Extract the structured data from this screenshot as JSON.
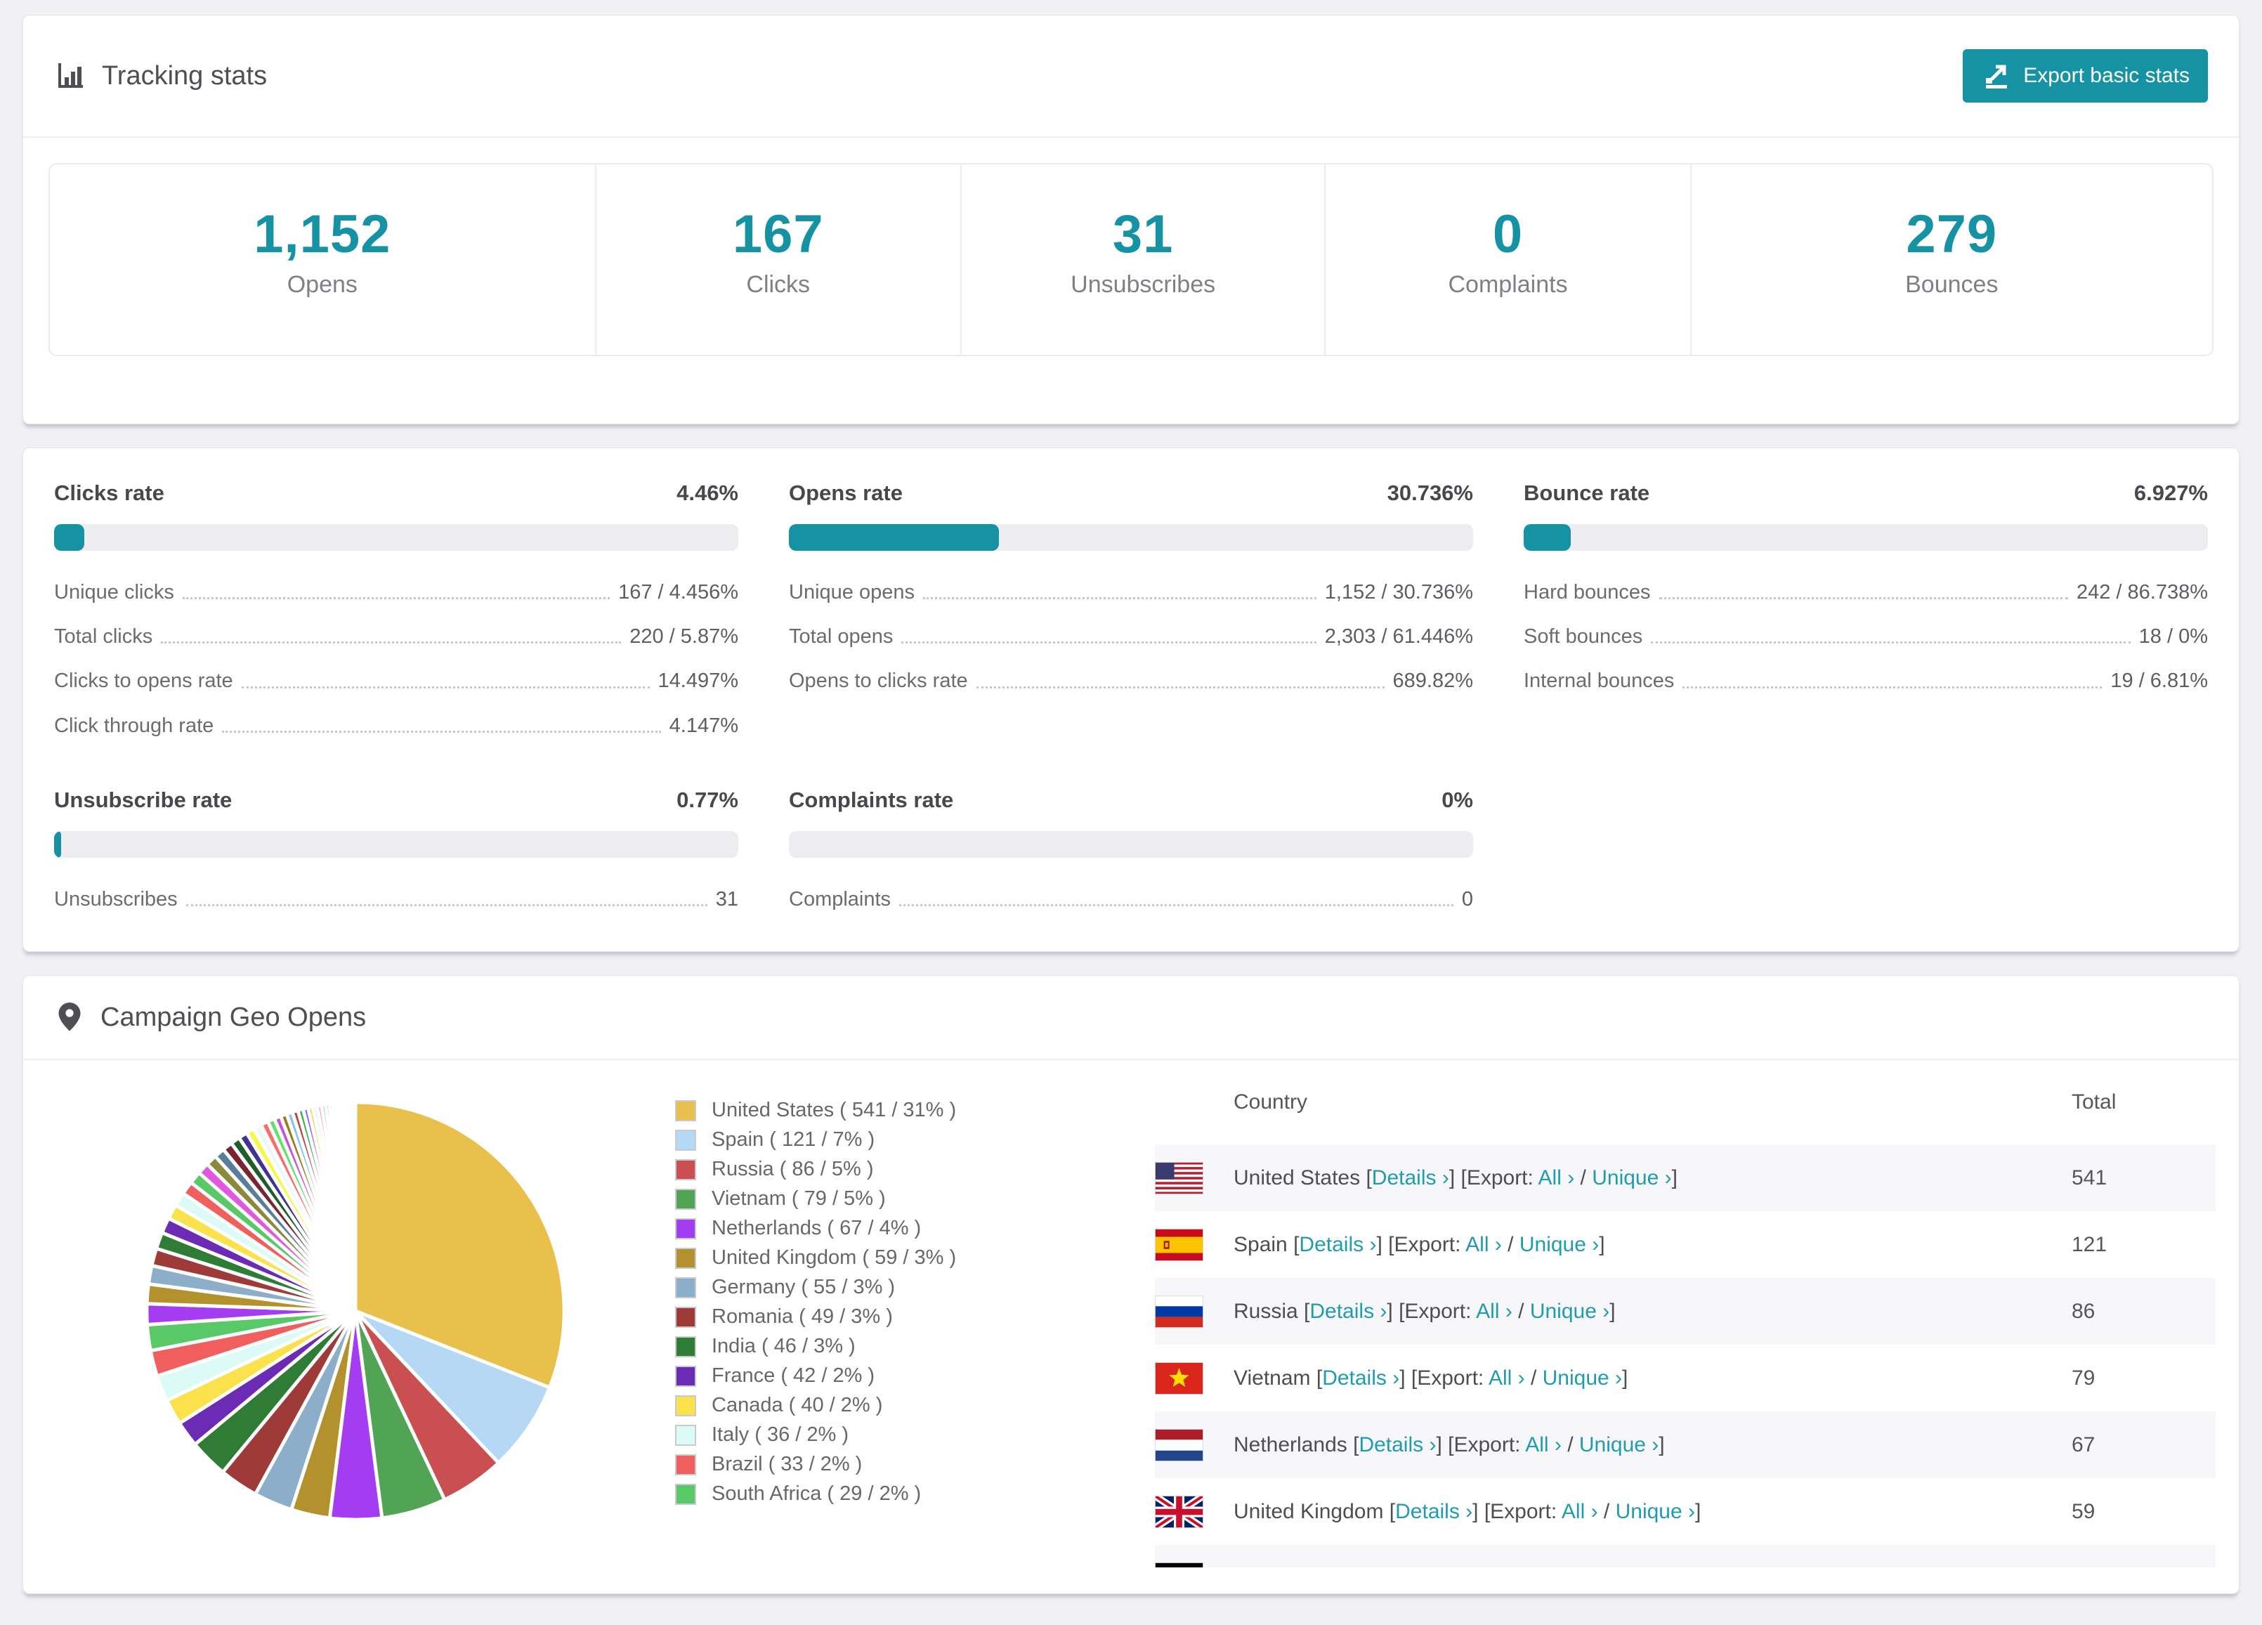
{
  "colors": {
    "accent": "#1592a3",
    "link": "#1f9cae"
  },
  "tracking": {
    "title": "Tracking stats",
    "export_label": "Export basic stats",
    "cards": [
      {
        "value": "1,152",
        "label": "Opens"
      },
      {
        "value": "167",
        "label": "Clicks"
      },
      {
        "value": "31",
        "label": "Unsubscribes"
      },
      {
        "value": "0",
        "label": "Complaints"
      },
      {
        "value": "279",
        "label": "Bounces"
      }
    ]
  },
  "rates": {
    "blocks": [
      {
        "id": "clicks",
        "title": "Clicks rate",
        "percent_label": "4.46%",
        "percent_value": 4.46,
        "rows": [
          [
            "Unique clicks",
            "167 / 4.456%"
          ],
          [
            "Total clicks",
            "220 / 5.87%"
          ],
          [
            "Clicks to opens rate",
            "14.497%"
          ],
          [
            "Click through rate",
            "4.147%"
          ]
        ]
      },
      {
        "id": "opens",
        "title": "Opens rate",
        "percent_label": "30.736%",
        "percent_value": 30.736,
        "rows": [
          [
            "Unique opens",
            "1,152 / 30.736%"
          ],
          [
            "Total opens",
            "2,303 / 61.446%"
          ],
          [
            "Opens to clicks rate",
            "689.82%"
          ]
        ]
      },
      {
        "id": "bounce",
        "title": "Bounce rate",
        "percent_label": "6.927%",
        "percent_value": 6.927,
        "rows": [
          [
            "Hard bounces",
            "242 / 86.738%"
          ],
          [
            "Soft bounces",
            "18 / 0%"
          ],
          [
            "Internal bounces",
            "19 / 6.81%"
          ]
        ]
      },
      {
        "id": "unsubscribe",
        "title": "Unsubscribe rate",
        "percent_label": "0.77%",
        "percent_value": 0.77,
        "rows": [
          [
            "Unsubscribes",
            "31"
          ]
        ]
      },
      {
        "id": "complaints",
        "title": "Complaints rate",
        "percent_label": "0%",
        "percent_value": 0,
        "rows": [
          [
            "Complaints",
            "0"
          ]
        ]
      }
    ]
  },
  "geo": {
    "title": "Campaign Geo Opens",
    "chart_data": {
      "type": "pie",
      "legend_position": "right",
      "series": [
        {
          "name": "United States",
          "value": 541,
          "percent": 31,
          "color": "#e9c04b"
        },
        {
          "name": "Spain",
          "value": 121,
          "percent": 7,
          "color": "#b5d8f5"
        },
        {
          "name": "Russia",
          "value": 86,
          "percent": 5,
          "color": "#c94f50"
        },
        {
          "name": "Vietnam",
          "value": 79,
          "percent": 5,
          "color": "#52a455"
        },
        {
          "name": "Netherlands",
          "value": 67,
          "percent": 4,
          "color": "#a43df2"
        },
        {
          "name": "United Kingdom",
          "value": 59,
          "percent": 3,
          "color": "#b3922e"
        },
        {
          "name": "Germany",
          "value": 55,
          "percent": 3,
          "color": "#8caec9"
        },
        {
          "name": "Romania",
          "value": 49,
          "percent": 3,
          "color": "#9e3b38"
        },
        {
          "name": "India",
          "value": 46,
          "percent": 3,
          "color": "#2e7c35"
        },
        {
          "name": "France",
          "value": 42,
          "percent": 2,
          "color": "#6c2bb4"
        },
        {
          "name": "Canada",
          "value": 40,
          "percent": 2,
          "color": "#fbe14b"
        },
        {
          "name": "Italy",
          "value": 36,
          "percent": 2,
          "color": "#dcfbf7"
        },
        {
          "name": "Brazil",
          "value": 33,
          "percent": 2,
          "color": "#f15e5e"
        },
        {
          "name": "South Africa",
          "value": 29,
          "percent": 2,
          "color": "#59c867"
        }
      ],
      "others": {
        "count": 40,
        "start_percent": 1.6,
        "decay": 0.945,
        "colors": [
          "#a43df2",
          "#b3922e",
          "#8caec9",
          "#9e3b38",
          "#2e7c35",
          "#6c2bb4",
          "#fbe14b",
          "#dcfbf7",
          "#f15e5e",
          "#59c867",
          "#e157e0",
          "#8a8a3a",
          "#5a7d9a",
          "#7a2430",
          "#1f5d2a",
          "#403394",
          "#f7f74a",
          "#eef7ff",
          "#fa6b6b",
          "#67e06b",
          "#c44fd9",
          "#9a7b20",
          "#88c4f0",
          "#c23b3b",
          "#3fae4c",
          "#8b5cf6",
          "#ffd34d",
          "#d0f4ff",
          "#ff8787",
          "#4ade80"
        ]
      }
    },
    "table": {
      "columns": [
        "Country",
        "Total"
      ],
      "links": {
        "details": "Details ›",
        "all": "All ›",
        "unique": "Unique ›"
      },
      "tokens": {
        "before_details": " [",
        "before_all": "] [Export: ",
        "separator": " / ",
        "after": "]"
      },
      "rows": [
        {
          "country": "United States",
          "flag": "us",
          "total": "541"
        },
        {
          "country": "Spain",
          "flag": "es",
          "total": "121"
        },
        {
          "country": "Russia",
          "flag": "ru",
          "total": "86"
        },
        {
          "country": "Vietnam",
          "flag": "vn",
          "total": "79"
        },
        {
          "country": "Netherlands",
          "flag": "nl",
          "total": "67"
        },
        {
          "country": "United Kingdom",
          "flag": "gb",
          "total": "59"
        },
        {
          "country": "",
          "flag": "de",
          "total": "",
          "partial": true
        }
      ]
    }
  }
}
